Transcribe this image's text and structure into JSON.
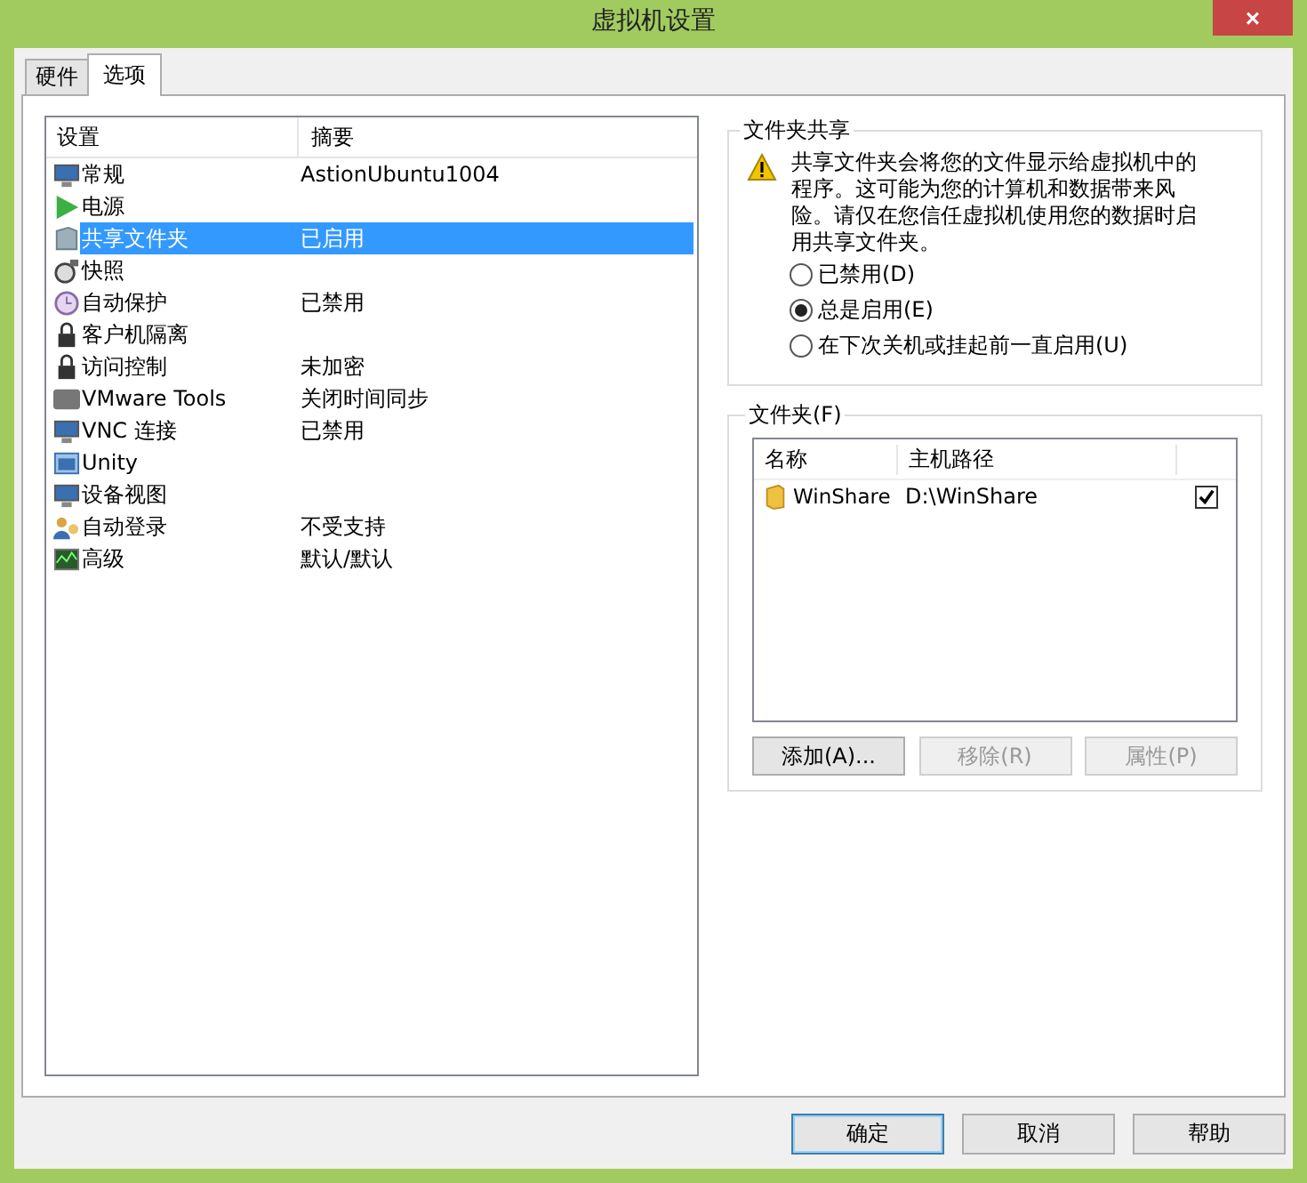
{
  "window": {
    "title": "虚拟机设置",
    "close": "×"
  },
  "tabs": [
    {
      "label": "硬件",
      "selected": false
    },
    {
      "label": "选项",
      "selected": true
    }
  ],
  "settings": {
    "columns": [
      "设置",
      "摘要"
    ],
    "rows": [
      {
        "name": "常规",
        "summary": "AstionUbuntu1004",
        "selected": false
      },
      {
        "name": "电源",
        "selected": false
      },
      {
        "name": "共享文件夹",
        "summary": "已启用",
        "selected": true
      },
      {
        "name": "快照",
        "selected": false
      },
      {
        "name": "自动保护",
        "summary": "已禁用",
        "selected": false
      },
      {
        "name": "客户机隔离",
        "selected": false
      },
      {
        "name": "访问控制",
        "summary": "未加密",
        "selected": false
      },
      {
        "name": "VMware Tools",
        "summary": "关闭时间同步",
        "selected": false
      },
      {
        "name": "VNC 连接",
        "summary": "已禁用",
        "selected": false
      },
      {
        "name": "Unity",
        "selected": false
      },
      {
        "name": "设备视图",
        "selected": false
      },
      {
        "name": "自动登录",
        "summary": "不受支持",
        "selected": false
      },
      {
        "name": "高级",
        "summary": "默认/默认",
        "selected": false
      }
    ]
  },
  "sharing": {
    "title": "文件夹共享",
    "warning": "共享文件夹会将您的文件显示给虚拟机中的程序。这可能为您的计算机和数据带来风险。请仅在您信任虚拟机使用您的数据时启用共享文件夹。",
    "options": [
      {
        "label": "已禁用(D)",
        "selected": false
      },
      {
        "label": "总是启用(E)",
        "selected": true
      },
      {
        "label": "在下次关机或挂起前一直启用(U)",
        "selected": false
      }
    ]
  },
  "folders": {
    "title": "文件夹(F)",
    "columns": [
      "名称",
      "主机路径"
    ],
    "rows": [
      {
        "name": "WinShare",
        "path": "D:\\WinShare",
        "checked": true
      }
    ],
    "buttons": [
      {
        "label": "添加(A)...",
        "disabled": false
      },
      {
        "label": "移除(R)",
        "disabled": true
      },
      {
        "label": "属性(P)",
        "disabled": true
      }
    ]
  },
  "buttons": [
    {
      "label": "确定",
      "default": true
    },
    {
      "label": "取消",
      "default": false
    },
    {
      "label": "帮助",
      "default": false
    }
  ]
}
